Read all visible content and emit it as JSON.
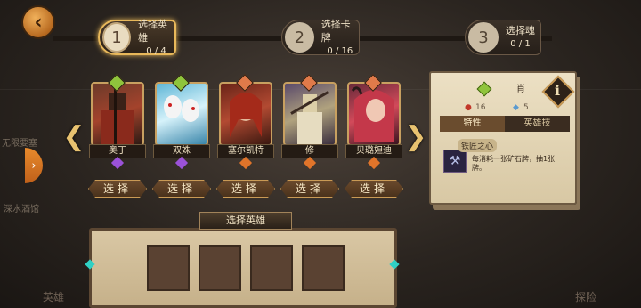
{
  "background_labels": {
    "left_top": "无限要塞",
    "left_bottom": "深水酒馆",
    "bottom_left": "英雄",
    "bottom_right": "探险"
  },
  "steps": [
    {
      "num": "1",
      "label": "选择英雄",
      "progress": "0 / 4",
      "state": "active"
    },
    {
      "num": "2",
      "label": "选择卡牌",
      "progress": "0 / 16",
      "state": "inactive"
    },
    {
      "num": "3",
      "label": "选择魂",
      "progress": "0 / 1",
      "state": "inactive"
    }
  ],
  "heroes": [
    {
      "name": "奥丁",
      "gem_color": "#8fc43c",
      "pip_color": "#9b52d8",
      "select": "选择"
    },
    {
      "name": "双姝",
      "gem_color": "#8fc43c",
      "pip_color": "#9b52d8",
      "select": "选择"
    },
    {
      "name": "塞尔凯特",
      "gem_color": "#e07a4a",
      "pip_color": "#e0742a",
      "select": "选择"
    },
    {
      "name": "修",
      "gem_color": "#e07a4a",
      "pip_color": "#e0742a",
      "select": "选择"
    },
    {
      "name": "贝璐妲迪",
      "gem_color": "#e07a4a",
      "pip_color": "#e0742a",
      "select": "选择"
    }
  ],
  "deck": {
    "title": "选择英雄"
  },
  "info": {
    "name": "肖",
    "stat_hp": "16",
    "stat_other": "5",
    "tabs": [
      "特性",
      "英雄技"
    ],
    "trait_title": "铁匠之心",
    "trait_desc": "每消耗一张矿石牌，抽1张牌。"
  },
  "colors": {
    "accent_gold": "#e8b85a",
    "panel_parchment": "#ece0c4"
  }
}
